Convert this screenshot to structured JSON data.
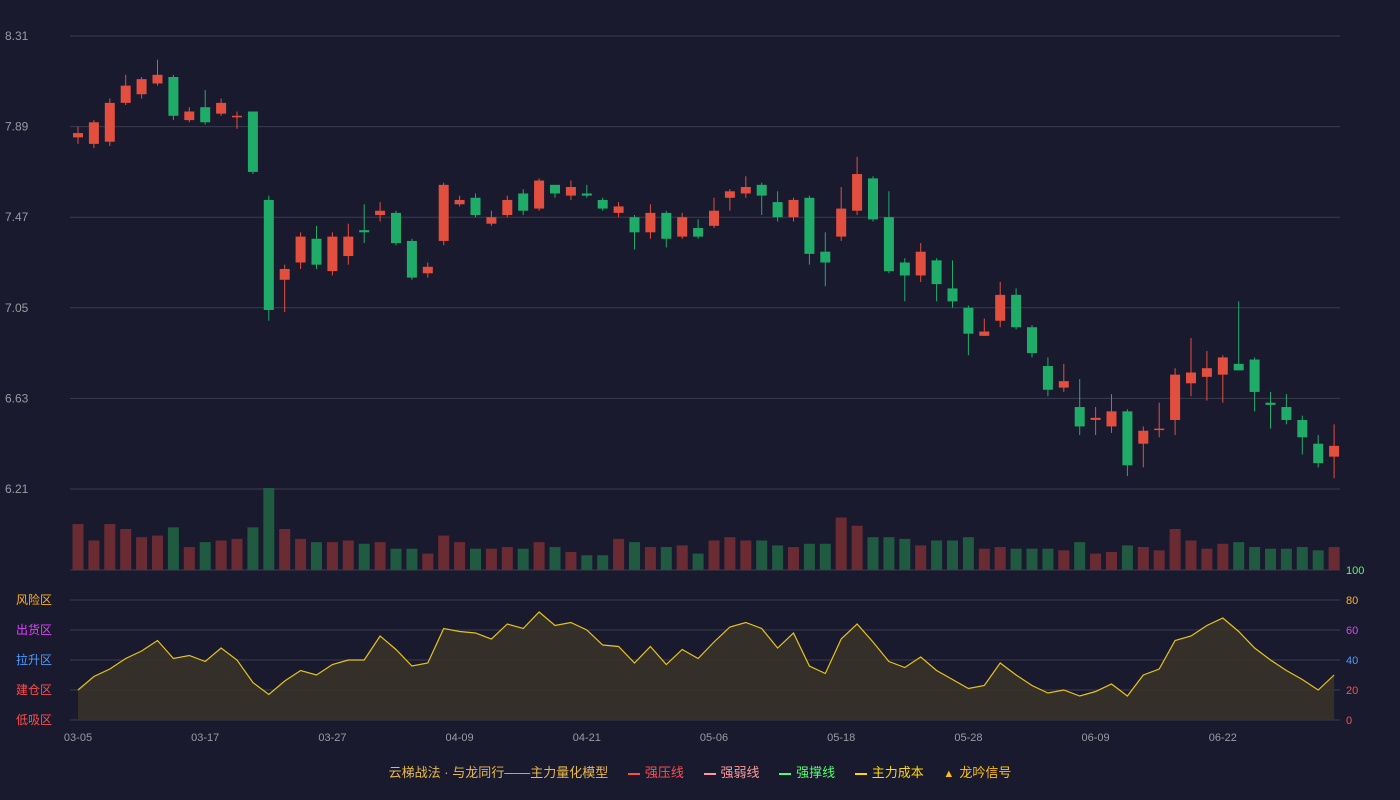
{
  "colors": {
    "background": "#1a1a2e",
    "grid": "#3a3d4e",
    "axis_text": "#9a9ba3",
    "up": "#e34f3f",
    "down": "#1fac69",
    "vol_up": "#6b2b33",
    "vol_down": "#1f5a41",
    "indicator": "#e8c21a",
    "indicator_fill": "#3a3428"
  },
  "legend": [
    {
      "label": "云梯战法 · 与龙同行——主力量化模型",
      "symbol": "none",
      "color": "#e8b84a"
    },
    {
      "label": "强压线",
      "symbol": "line",
      "color": "#ff4d4d"
    },
    {
      "label": "强弱线",
      "symbol": "dash",
      "color": "#ff9a9a"
    },
    {
      "label": "强撑线",
      "symbol": "line",
      "color": "#4dff6a"
    },
    {
      "label": "主力成本",
      "symbol": "dash",
      "color": "#ffd700"
    },
    {
      "label": "龙吟信号",
      "symbol": "triangle",
      "color": "#ffc107"
    }
  ],
  "zone_labels": [
    {
      "label": "风险区",
      "value": 80,
      "color": "#ffb020"
    },
    {
      "label": "出货区",
      "value": 60,
      "color": "#e040fb"
    },
    {
      "label": "拉升区",
      "value": 40,
      "color": "#4a9cff"
    },
    {
      "label": "建仓区",
      "value": 20,
      "color": "#ff4d4d"
    },
    {
      "label": "低吸区",
      "value": 0,
      "color": "#ff4d4d"
    }
  ],
  "right_axis_ticks": [
    {
      "label": "100",
      "value": 100,
      "color": "#4dff6a"
    },
    {
      "label": "80",
      "value": 80,
      "color": "#ffb020"
    },
    {
      "label": "60",
      "value": 60,
      "color": "#e040fb"
    },
    {
      "label": "40",
      "value": 40,
      "color": "#4a9cff"
    },
    {
      "label": "20",
      "value": 20,
      "color": "#ff4d4d"
    },
    {
      "label": "0",
      "value": 0,
      "color": "#ff4d4d"
    }
  ],
  "chart_data": {
    "type": "candlestick",
    "price_axis": {
      "ticks": [
        "6.21",
        "6.63",
        "7.05",
        "7.47",
        "7.89",
        "8.31"
      ],
      "ylim": [
        6.21,
        8.31
      ]
    },
    "indicator_axis": {
      "ylim": [
        0,
        100
      ]
    },
    "x_tick_labels": [
      {
        "index": 0,
        "label": "03-05"
      },
      {
        "index": 8,
        "label": "03-17"
      },
      {
        "index": 16,
        "label": "03-27"
      },
      {
        "index": 24,
        "label": "04-09"
      },
      {
        "index": 32,
        "label": "04-21"
      },
      {
        "index": 40,
        "label": "05-06"
      },
      {
        "index": 48,
        "label": "05-18"
      },
      {
        "index": 56,
        "label": "05-28"
      },
      {
        "index": 64,
        "label": "06-09"
      },
      {
        "index": 72,
        "label": "06-22"
      }
    ],
    "ohlc": [
      [
        7.84,
        7.86,
        7.81,
        7.89
      ],
      [
        7.81,
        7.91,
        7.79,
        7.92
      ],
      [
        7.82,
        8.0,
        7.8,
        8.02
      ],
      [
        8.0,
        8.08,
        7.99,
        8.13
      ],
      [
        8.04,
        8.11,
        8.02,
        8.12
      ],
      [
        8.09,
        8.13,
        8.08,
        8.2
      ],
      [
        8.12,
        7.94,
        7.92,
        8.13
      ],
      [
        7.92,
        7.96,
        7.91,
        7.98
      ],
      [
        7.98,
        7.91,
        7.9,
        8.06
      ],
      [
        7.95,
        8.0,
        7.94,
        8.02
      ],
      [
        7.94,
        7.94,
        7.88,
        7.96
      ],
      [
        7.96,
        7.68,
        7.67,
        7.96
      ],
      [
        7.55,
        7.04,
        6.99,
        7.57
      ],
      [
        7.18,
        7.23,
        7.03,
        7.25
      ],
      [
        7.26,
        7.38,
        7.23,
        7.4
      ],
      [
        7.37,
        7.25,
        7.23,
        7.43
      ],
      [
        7.22,
        7.38,
        7.2,
        7.4
      ],
      [
        7.29,
        7.38,
        7.25,
        7.44
      ],
      [
        7.41,
        7.4,
        7.35,
        7.53
      ],
      [
        7.48,
        7.5,
        7.45,
        7.54
      ],
      [
        7.49,
        7.35,
        7.34,
        7.5
      ],
      [
        7.36,
        7.19,
        7.18,
        7.37
      ],
      [
        7.21,
        7.24,
        7.19,
        7.26
      ],
      [
        7.36,
        7.62,
        7.34,
        7.63
      ],
      [
        7.53,
        7.55,
        7.52,
        7.57
      ],
      [
        7.56,
        7.48,
        7.47,
        7.58
      ],
      [
        7.44,
        7.47,
        7.43,
        7.5
      ],
      [
        7.48,
        7.55,
        7.47,
        7.57
      ],
      [
        7.58,
        7.5,
        7.48,
        7.6
      ],
      [
        7.51,
        7.64,
        7.5,
        7.65
      ],
      [
        7.62,
        7.58,
        7.56,
        7.62
      ],
      [
        7.57,
        7.61,
        7.55,
        7.64
      ],
      [
        7.58,
        7.57,
        7.56,
        7.62
      ],
      [
        7.55,
        7.51,
        7.5,
        7.56
      ],
      [
        7.49,
        7.52,
        7.47,
        7.54
      ],
      [
        7.47,
        7.4,
        7.32,
        7.48
      ],
      [
        7.4,
        7.49,
        7.37,
        7.53
      ],
      [
        7.49,
        7.37,
        7.33,
        7.5
      ],
      [
        7.38,
        7.47,
        7.37,
        7.49
      ],
      [
        7.42,
        7.38,
        7.37,
        7.46
      ],
      [
        7.43,
        7.5,
        7.42,
        7.56
      ],
      [
        7.56,
        7.59,
        7.5,
        7.6
      ],
      [
        7.58,
        7.61,
        7.56,
        7.66
      ],
      [
        7.62,
        7.57,
        7.48,
        7.63
      ],
      [
        7.54,
        7.47,
        7.45,
        7.59
      ],
      [
        7.47,
        7.55,
        7.45,
        7.56
      ],
      [
        7.56,
        7.3,
        7.25,
        7.57
      ],
      [
        7.31,
        7.26,
        7.15,
        7.4
      ],
      [
        7.38,
        7.51,
        7.36,
        7.61
      ],
      [
        7.5,
        7.67,
        7.48,
        7.75
      ],
      [
        7.65,
        7.46,
        7.45,
        7.66
      ],
      [
        7.47,
        7.22,
        7.21,
        7.59
      ],
      [
        7.26,
        7.2,
        7.08,
        7.28
      ],
      [
        7.2,
        7.31,
        7.17,
        7.35
      ],
      [
        7.27,
        7.16,
        7.08,
        7.28
      ],
      [
        7.14,
        7.08,
        7.05,
        7.27
      ],
      [
        7.05,
        6.93,
        6.83,
        7.06
      ],
      [
        6.92,
        6.94,
        6.92,
        7.0
      ],
      [
        6.99,
        7.11,
        6.96,
        7.17
      ],
      [
        7.11,
        6.96,
        6.95,
        7.14
      ],
      [
        6.96,
        6.84,
        6.82,
        6.97
      ],
      [
        6.78,
        6.67,
        6.64,
        6.82
      ],
      [
        6.68,
        6.71,
        6.66,
        6.79
      ],
      [
        6.59,
        6.5,
        6.46,
        6.72
      ],
      [
        6.53,
        6.54,
        6.46,
        6.59
      ],
      [
        6.5,
        6.57,
        6.47,
        6.65
      ],
      [
        6.57,
        6.32,
        6.27,
        6.58
      ],
      [
        6.42,
        6.48,
        6.31,
        6.5
      ],
      [
        6.49,
        6.49,
        6.45,
        6.61
      ],
      [
        6.53,
        6.74,
        6.46,
        6.77
      ],
      [
        6.7,
        6.75,
        6.64,
        6.91
      ],
      [
        6.73,
        6.77,
        6.62,
        6.85
      ],
      [
        6.74,
        6.82,
        6.61,
        6.83
      ],
      [
        6.79,
        6.76,
        6.76,
        7.08
      ],
      [
        6.81,
        6.66,
        6.57,
        6.82
      ],
      [
        6.61,
        6.6,
        6.49,
        6.66
      ],
      [
        6.59,
        6.53,
        6.51,
        6.65
      ],
      [
        6.53,
        6.45,
        6.37,
        6.55
      ],
      [
        6.42,
        6.33,
        6.31,
        6.46
      ],
      [
        6.36,
        6.41,
        6.26,
        6.51
      ]
    ],
    "volume": [
      28,
      18,
      28,
      25,
      20,
      21,
      26,
      14,
      17,
      18,
      19,
      26,
      50,
      25,
      19,
      17,
      17,
      18,
      16,
      17,
      13,
      13,
      10,
      21,
      17,
      13,
      13,
      14,
      13,
      17,
      14,
      11,
      9,
      9,
      19,
      17,
      14,
      14,
      15,
      10,
      18,
      20,
      18,
      18,
      15,
      14,
      16,
      16,
      32,
      27,
      20,
      20,
      19,
      15,
      18,
      18,
      20,
      13,
      14,
      13,
      13,
      13,
      12,
      17,
      10,
      11,
      15,
      14,
      12,
      25,
      18,
      13,
      16,
      17,
      14,
      13,
      13,
      14,
      12,
      14
    ],
    "indicator": [
      20,
      29,
      34,
      41,
      46,
      53,
      41,
      43,
      39,
      48,
      40,
      25,
      17,
      26,
      33,
      30,
      37,
      40,
      40,
      56,
      47,
      36,
      38,
      61,
      59,
      58,
      54,
      64,
      61,
      72,
      63,
      65,
      60,
      50,
      49,
      38,
      49,
      37,
      47,
      41,
      52,
      62,
      65,
      61,
      48,
      58,
      36,
      31,
      54,
      64,
      52,
      39,
      35,
      42,
      33,
      27,
      21,
      23,
      38,
      30,
      23,
      18,
      20,
      16,
      19,
      24,
      16,
      30,
      34,
      53,
      56,
      63,
      68,
      59,
      48,
      40,
      33,
      27,
      20,
      30
    ]
  }
}
